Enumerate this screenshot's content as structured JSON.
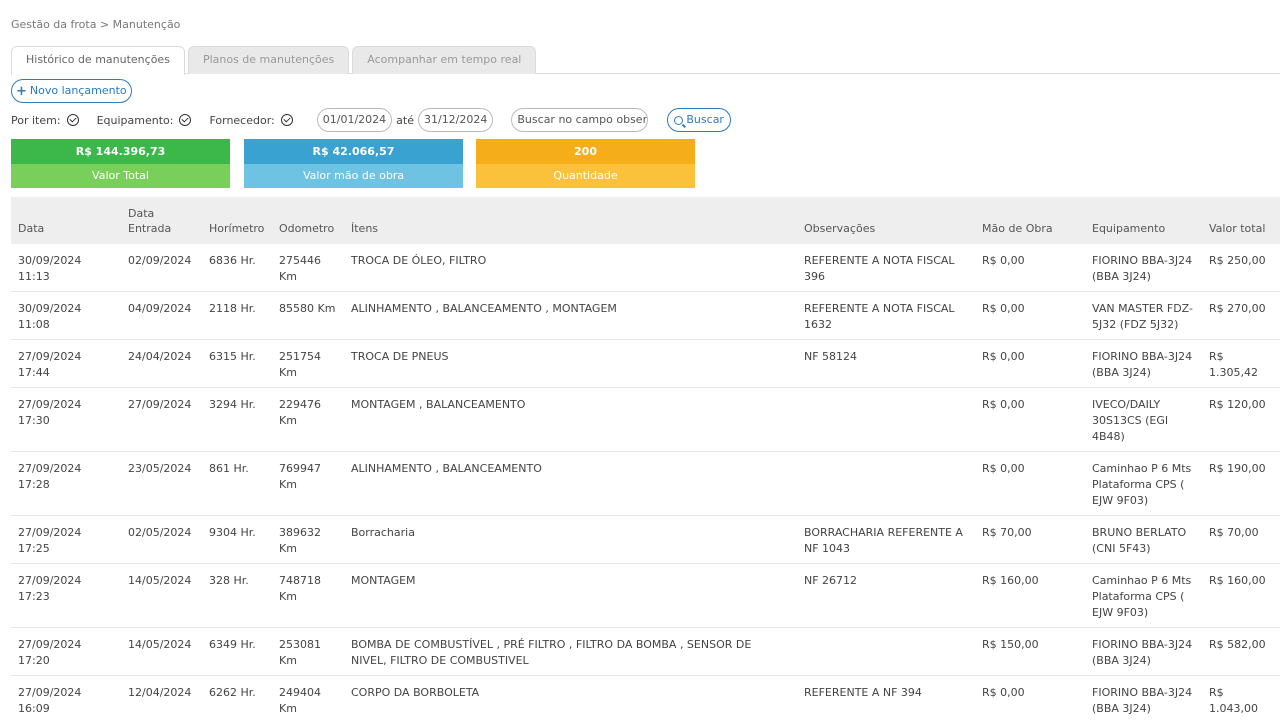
{
  "breadcrumb": "Gestão da frota > Manutenção",
  "tabs": [
    {
      "label": "Histórico de manutenções",
      "active": true
    },
    {
      "label": "Planos de manutenções",
      "active": false
    },
    {
      "label": "Acompanhar em tempo real",
      "active": false
    }
  ],
  "new_button_label": "Novo lançamento",
  "filters": {
    "por_item": "Por item:",
    "equipamento": "Equipamento:",
    "fornecedor": "Fornecedor:",
    "date_from": "01/01/2024",
    "ate": "até",
    "date_to": "31/12/2024",
    "search_placeholder": "Buscar no campo observações",
    "search_button": "Buscar"
  },
  "summary": {
    "total_value": "R$ 144.396,73",
    "total_label": "Valor Total",
    "labor_value": "R$ 42.066,57",
    "labor_label": "Valor mão de obra",
    "quantity_value": "200",
    "quantity_label": "Quantidade"
  },
  "colors": {
    "green_top": "#3cb84b",
    "green_bot": "#78d05a",
    "blue_top": "#3aa2d0",
    "blue_bot": "#6ec2e2",
    "orange_top": "#f5ae19",
    "orange_bot": "#fbc13a",
    "accent": "#2b7bbf"
  },
  "table": {
    "headers": [
      "Data",
      "Data Entrada",
      "Horímetro",
      "Odometro",
      "Ítens",
      "Observações",
      "Mão de Obra",
      "Equipamento",
      "Valor total"
    ],
    "rows": [
      [
        "30/09/2024 11:13",
        "02/09/2024",
        "6836 Hr.",
        "275446 Km",
        "TROCA DE ÓLEO, FILTRO",
        "REFERENTE A NOTA FISCAL 396",
        "R$ 0,00",
        "FIORINO BBA-3J24 (BBA 3J24)",
        "R$ 250,00"
      ],
      [
        "30/09/2024 11:08",
        "04/09/2024",
        "2118 Hr.",
        "85580 Km",
        "ALINHAMENTO , BALANCEAMENTO , MONTAGEM",
        "REFERENTE A NOTA FISCAL 1632",
        "R$ 0,00",
        "VAN MASTER FDZ-5J32 (FDZ 5J32)",
        "R$ 270,00"
      ],
      [
        "27/09/2024 17:44",
        "24/04/2024",
        "6315 Hr.",
        "251754 Km",
        "TROCA DE PNEUS",
        "NF 58124",
        "R$ 0,00",
        "FIORINO BBA-3J24 (BBA 3J24)",
        "R$ 1.305,42"
      ],
      [
        "27/09/2024 17:30",
        "27/09/2024",
        "3294 Hr.",
        "229476 Km",
        "MONTAGEM , BALANCEAMENTO",
        "",
        "R$ 0,00",
        "IVECO/DAILY 30S13CS (EGI 4B48)",
        "R$ 120,00"
      ],
      [
        "27/09/2024 17:28",
        "23/05/2024",
        "861 Hr.",
        "769947 Km",
        "ALINHAMENTO , BALANCEAMENTO",
        "",
        "R$ 0,00",
        "Caminhao P 6 Mts Plataforma CPS ( EJW 9F03)",
        "R$ 190,00"
      ],
      [
        "27/09/2024 17:25",
        "02/05/2024",
        "9304 Hr.",
        "389632 Km",
        "Borracharia",
        "BORRACHARIA REFERENTE A NF 1043",
        "R$ 70,00",
        "BRUNO BERLATO (CNI 5F43)",
        "R$ 70,00"
      ],
      [
        "27/09/2024 17:23",
        "14/05/2024",
        "328 Hr.",
        "748718 Km",
        "MONTAGEM",
        "NF 26712",
        "R$ 160,00",
        "Caminhao P 6 Mts Plataforma CPS ( EJW 9F03)",
        "R$ 160,00"
      ],
      [
        "27/09/2024 17:20",
        "14/05/2024",
        "6349 Hr.",
        "253081 Km",
        "BOMBA DE COMBUSTÍVEL , PRÉ FILTRO , FILTRO DA BOMBA , SENSOR DE NIVEL, FILTRO DE COMBUSTIVEL",
        "",
        "R$ 150,00",
        "FIORINO BBA-3J24 (BBA 3J24)",
        "R$ 582,00"
      ],
      [
        "27/09/2024 16:09",
        "12/04/2024",
        "6262 Hr.",
        "249404 Km",
        "CORPO DA BORBOLETA",
        "REFERENTE A NF 394",
        "R$ 0,00",
        "FIORINO BBA-3J24 (BBA 3J24)",
        "R$ 1.043,00"
      ]
    ]
  }
}
